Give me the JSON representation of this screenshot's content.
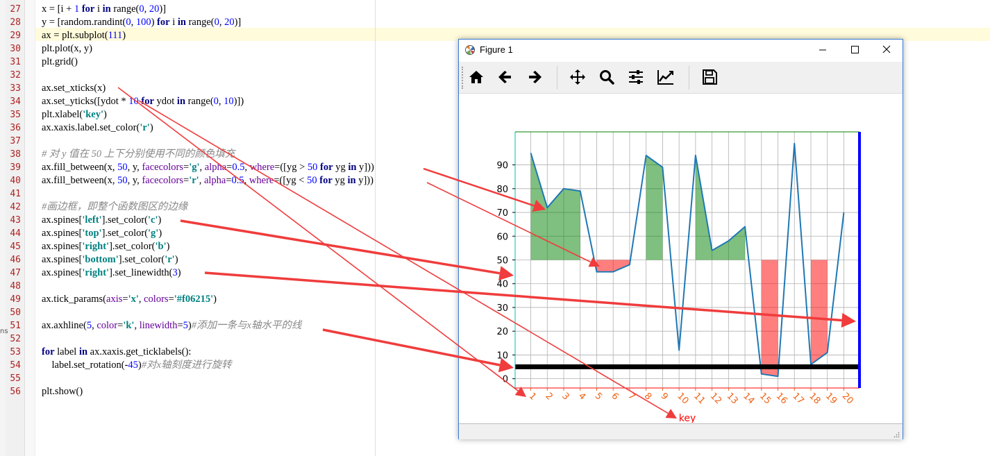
{
  "editor": {
    "lines": [
      {
        "num": "27",
        "tokens": [
          [
            "",
            "x = [i + "
          ],
          [
            "num",
            "1"
          ],
          [
            "",
            " "
          ],
          [
            "kw",
            "for"
          ],
          [
            "",
            " i "
          ],
          [
            "kw",
            "in"
          ],
          [
            "",
            " range("
          ],
          [
            "num",
            "0"
          ],
          [
            "",
            ", "
          ],
          [
            "num",
            "20"
          ],
          [
            "",
            ")]"
          ]
        ]
      },
      {
        "num": "28",
        "tokens": [
          [
            "",
            "y = [random.randint("
          ],
          [
            "num",
            "0"
          ],
          [
            "",
            ", "
          ],
          [
            "num",
            "100"
          ],
          [
            "",
            ") "
          ],
          [
            "kw",
            "for"
          ],
          [
            "",
            " i "
          ],
          [
            "kw",
            "in"
          ],
          [
            "",
            " range("
          ],
          [
            "num",
            "0"
          ],
          [
            "",
            ", "
          ],
          [
            "num",
            "20"
          ],
          [
            "",
            ")]"
          ]
        ]
      },
      {
        "num": "29",
        "tokens": [
          [
            "",
            "ax = plt.subplot("
          ],
          [
            "num",
            "111"
          ],
          [
            "",
            ")"
          ]
        ]
      },
      {
        "num": "30",
        "tokens": [
          [
            "",
            "plt.plot(x, y)"
          ]
        ]
      },
      {
        "num": "31",
        "tokens": [
          [
            "",
            "plt.grid()"
          ]
        ]
      },
      {
        "num": "32",
        "tokens": []
      },
      {
        "num": "33",
        "tokens": [
          [
            "",
            "ax.set_xticks(x)"
          ]
        ]
      },
      {
        "num": "34",
        "tokens": [
          [
            "",
            "ax.set_yticks([ydot * "
          ],
          [
            "num",
            "10"
          ],
          [
            "",
            " "
          ],
          [
            "kw",
            "for"
          ],
          [
            "",
            " ydot "
          ],
          [
            "kw",
            "in"
          ],
          [
            "",
            " range("
          ],
          [
            "num",
            "0"
          ],
          [
            "",
            ", "
          ],
          [
            "num",
            "10"
          ],
          [
            "",
            ")])"
          ]
        ]
      },
      {
        "num": "35",
        "tokens": [
          [
            "",
            "plt.xlabel("
          ],
          [
            "str",
            "'key'"
          ],
          [
            "",
            ")"
          ]
        ]
      },
      {
        "num": "36",
        "tokens": [
          [
            "",
            "ax.xaxis.label.set_color("
          ],
          [
            "str",
            "'r'"
          ],
          [
            "",
            ")"
          ]
        ]
      },
      {
        "num": "37",
        "tokens": []
      },
      {
        "num": "38",
        "tokens": [
          [
            "cm",
            "# 对 y 值在 50 上下分别使用不同的颜色填充"
          ]
        ]
      },
      {
        "num": "39",
        "tokens": [
          [
            "",
            "ax.fill_between(x, "
          ],
          [
            "num",
            "50"
          ],
          [
            "",
            ", y, "
          ],
          [
            "kwarg",
            "facecolors"
          ],
          [
            "",
            "="
          ],
          [
            "str",
            "'g'"
          ],
          [
            "",
            ", "
          ],
          [
            "kwarg",
            "alpha"
          ],
          [
            "",
            "="
          ],
          [
            "num",
            "0.5"
          ],
          [
            "",
            ", "
          ],
          [
            "kwarg",
            "where"
          ],
          [
            "",
            "=([yg > "
          ],
          [
            "num",
            "50"
          ],
          [
            "",
            " "
          ],
          [
            "kw",
            "for"
          ],
          [
            "",
            " yg "
          ],
          [
            "kw",
            "in"
          ],
          [
            "",
            " y]))"
          ]
        ]
      },
      {
        "num": "40",
        "tokens": [
          [
            "",
            "ax.fill_between(x, "
          ],
          [
            "num",
            "50"
          ],
          [
            "",
            ", y, "
          ],
          [
            "kwarg",
            "facecolors"
          ],
          [
            "",
            "="
          ],
          [
            "str",
            "'r'"
          ],
          [
            "",
            ", "
          ],
          [
            "kwarg",
            "alpha"
          ],
          [
            "",
            "="
          ],
          [
            "num",
            "0.5"
          ],
          [
            "",
            ", "
          ],
          [
            "kwarg",
            "where"
          ],
          [
            "",
            "=([yg < "
          ],
          [
            "num",
            "50"
          ],
          [
            "",
            " "
          ],
          [
            "kw",
            "for"
          ],
          [
            "",
            " yg "
          ],
          [
            "kw",
            "in"
          ],
          [
            "",
            " y]))"
          ]
        ]
      },
      {
        "num": "41",
        "tokens": []
      },
      {
        "num": "42",
        "tokens": [
          [
            "cm",
            "#画边框，即整个函数图区的边缘"
          ]
        ]
      },
      {
        "num": "43",
        "tokens": [
          [
            "",
            "ax.spines["
          ],
          [
            "str",
            "'left'"
          ],
          [
            "",
            "].set_color("
          ],
          [
            "str",
            "'c'"
          ],
          [
            "",
            ")"
          ]
        ]
      },
      {
        "num": "44",
        "tokens": [
          [
            "",
            "ax.spines["
          ],
          [
            "str",
            "'top'"
          ],
          [
            "",
            "].set_color("
          ],
          [
            "str",
            "'g'"
          ],
          [
            "",
            ")"
          ]
        ]
      },
      {
        "num": "45",
        "tokens": [
          [
            "",
            "ax.spines["
          ],
          [
            "str",
            "'right'"
          ],
          [
            "",
            "].set_color("
          ],
          [
            "str",
            "'b'"
          ],
          [
            "",
            ")"
          ]
        ]
      },
      {
        "num": "46",
        "tokens": [
          [
            "",
            "ax.spines["
          ],
          [
            "str",
            "'bottom'"
          ],
          [
            "",
            "].set_color("
          ],
          [
            "str",
            "'r'"
          ],
          [
            "",
            ")"
          ]
        ]
      },
      {
        "num": "47",
        "tokens": [
          [
            "",
            "ax.spines["
          ],
          [
            "str",
            "'right'"
          ],
          [
            "",
            "].set_linewidth("
          ],
          [
            "num",
            "3"
          ],
          [
            "",
            ")"
          ]
        ]
      },
      {
        "num": "48",
        "tokens": []
      },
      {
        "num": "49",
        "tokens": [
          [
            "",
            "ax.tick_params("
          ],
          [
            "kwarg",
            "axis"
          ],
          [
            "",
            "="
          ],
          [
            "str",
            "'x'"
          ],
          [
            "",
            ", "
          ],
          [
            "kwarg",
            "colors"
          ],
          [
            "",
            "="
          ],
          [
            "str",
            "'#f06215'"
          ],
          [
            "",
            ")"
          ]
        ]
      },
      {
        "num": "50",
        "tokens": []
      },
      {
        "num": "51",
        "tokens": [
          [
            "",
            "ax.axhline("
          ],
          [
            "num",
            "5"
          ],
          [
            "",
            ", "
          ],
          [
            "kwarg",
            "color"
          ],
          [
            "",
            "="
          ],
          [
            "str",
            "'k'"
          ],
          [
            "",
            ", "
          ],
          [
            "kwarg",
            "linewidth"
          ],
          [
            "",
            "="
          ],
          [
            "num",
            "5"
          ],
          [
            "",
            ")"
          ],
          [
            "cm",
            "#添加一条与x轴水平的线"
          ]
        ]
      },
      {
        "num": "52",
        "tokens": []
      },
      {
        "num": "53",
        "tokens": [
          [
            "kw",
            "for"
          ],
          [
            "",
            " label "
          ],
          [
            "kw",
            "in"
          ],
          [
            "",
            " ax.xaxis.get_ticklabels():"
          ]
        ]
      },
      {
        "num": "54",
        "tokens": [
          [
            "",
            "    label.set_rotation(-"
          ],
          [
            "num",
            "45"
          ],
          [
            "",
            ")"
          ],
          [
            "cm",
            "#对x轴刻度进行旋转"
          ]
        ]
      },
      {
        "num": "55",
        "tokens": []
      },
      {
        "num": "56",
        "tokens": [
          [
            "",
            "plt.show()"
          ]
        ]
      }
    ],
    "side_mark": "ns"
  },
  "figure_window": {
    "title": "Figure 1",
    "toolbar": [
      "home-icon",
      "back-icon",
      "forward-icon",
      "pan-icon",
      "zoom-icon",
      "configure-subplots-icon",
      "edit-axis-icon",
      "save-icon"
    ]
  },
  "chart_data": {
    "type": "line",
    "x": [
      1,
      2,
      3,
      4,
      5,
      6,
      7,
      8,
      9,
      10,
      11,
      12,
      13,
      14,
      15,
      16,
      17,
      18,
      19,
      20
    ],
    "y": [
      95,
      72,
      80,
      79,
      45,
      45,
      48,
      94,
      89,
      12,
      94,
      54,
      58,
      64,
      2,
      1,
      99,
      6,
      11,
      70
    ],
    "xticks": [
      "1",
      "2",
      "3",
      "4",
      "5",
      "6",
      "7",
      "8",
      "9",
      "10",
      "11",
      "12",
      "13",
      "14",
      "15",
      "16",
      "17",
      "18",
      "19",
      "20"
    ],
    "yticks": [
      "0",
      "10",
      "20",
      "30",
      "40",
      "50",
      "60",
      "70",
      "80",
      "90"
    ],
    "xlabel": "key",
    "xlim": [
      0.05,
      20.95
    ],
    "ylim": [
      -3.9,
      103.9
    ],
    "fill_threshold": 50,
    "fill_above_color": "#008000",
    "fill_below_color": "#ff0000",
    "fill_alpha": 0.5,
    "line_color": "#1f77b4",
    "axhline": {
      "y": 5,
      "color": "#000000"
    },
    "spines": {
      "left": "#00bfbf",
      "top": "#008000",
      "right": "#0000ff",
      "bottom": "#ff0000"
    },
    "xtick_color": "#f06215",
    "xlabel_color": "#ff0000",
    "grid": true
  },
  "annotations": {
    "arrow_color": "#f03c3c"
  }
}
